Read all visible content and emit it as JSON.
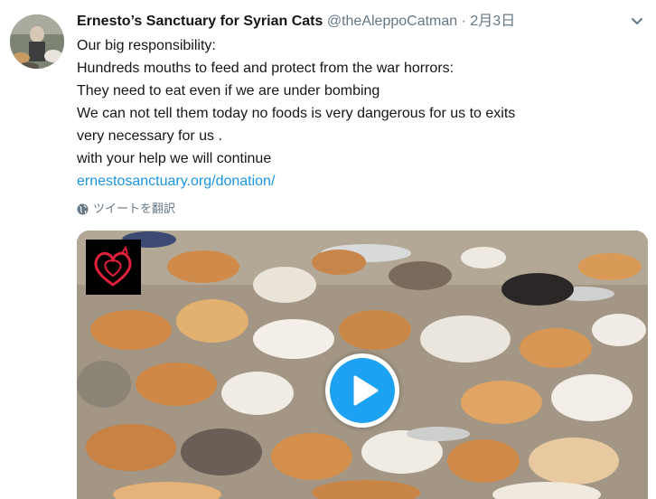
{
  "tweet": {
    "author_name": "Ernesto’s Sanctuary for Syrian Cats",
    "handle": "@theAleppoCatman",
    "separator": "·",
    "date": "2月3日",
    "lines": [
      "Our big responsibility:",
      "Hundreds mouths to feed and protect from the war horrors:",
      "They need to eat even if we are under bombing",
      "We can not tell them today no foods is very dangerous for us to exits",
      "very necessary for us .",
      "with your help we will continue"
    ],
    "link": "ernestosanctuary.org/donation/",
    "translate_label": "ツイートを翻訳"
  },
  "icons": {
    "caret": "chevron-down-icon",
    "globe": "globe-icon",
    "play": "play-icon",
    "logo": "heart-cat-logo"
  },
  "colors": {
    "link": "#1b95e0",
    "muted": "#657786",
    "play": "#1da1f2",
    "logo_heart": "#e0203a"
  }
}
